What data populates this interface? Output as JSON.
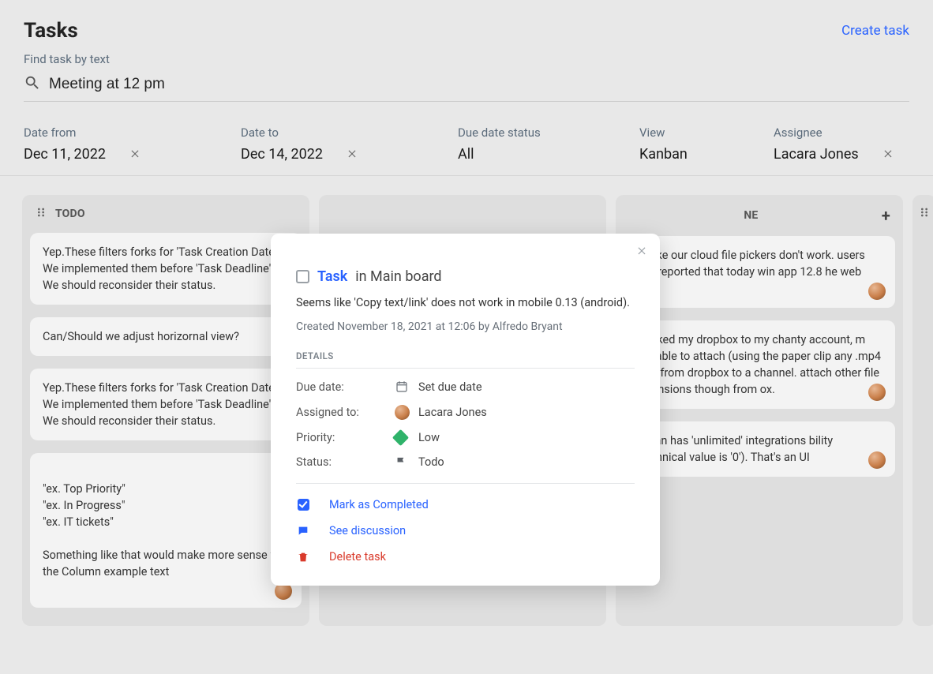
{
  "header": {
    "title": "Tasks",
    "create": "Create task"
  },
  "search": {
    "label": "Find task by text",
    "value": "Meeting at 12 pm"
  },
  "filters": {
    "date_from": {
      "label": "Date from",
      "value": "Dec 11, 2022"
    },
    "date_to": {
      "label": "Date to",
      "value": "Dec 14, 2022"
    },
    "due": {
      "label": "Due date status",
      "value": "All"
    },
    "view": {
      "label": "View",
      "value": "Kanban"
    },
    "assignee": {
      "label": "Assignee",
      "value": "Lacara Jones"
    }
  },
  "columns": {
    "todo": {
      "title": "TODO",
      "cards": [
        "Yep.These filters forks for 'Task Creation Date'. We implemented them before 'Task Deadline'. We should reconsider their status.",
        "Can/Should we adjust horizornal view?",
        "Yep.These filters forks for 'Task Creation Date'. We implemented them before 'Task Deadline'. We should reconsider their status.",
        "\"ex. Top Priority\"\n\"ex. In Progress\"\n\"ex. IT tickets\"\n\nSomething like that would make more sense fo. the Column example text"
      ]
    },
    "done": {
      "title_fragment": "NE",
      "cards": [
        "ks like our cloud file pickers don't work. users has reported that today win app 12.8 he web one",
        "e linked my dropbox to my chanty account, m not able to attach (using the paper clip any .mp4 files from dropbox to a channel. attach other file extensions though from ox.",
        "o plan has 'unlimited' integrations bility (technical value is '0'). That's an UI"
      ]
    }
  },
  "modal": {
    "link_label": "Task",
    "in_label": "in Main board",
    "description": "Seems like 'Copy text/link' does not work in mobile 0.13 (android).",
    "created": "Created November 18, 2021 at 12:06 by Alfredo Bryant",
    "details_header": "DETAILS",
    "details": {
      "due_label": "Due date:",
      "due_value": "Set due date",
      "ass_label": "Assigned to:",
      "ass_value": "Lacara Jones",
      "pri_label": "Priority:",
      "pri_value": "Low",
      "sta_label": "Status:",
      "sta_value": "Todo"
    },
    "actions": {
      "complete": "Mark as Completed",
      "discuss": "See discussion",
      "delete": "Delete task"
    }
  }
}
